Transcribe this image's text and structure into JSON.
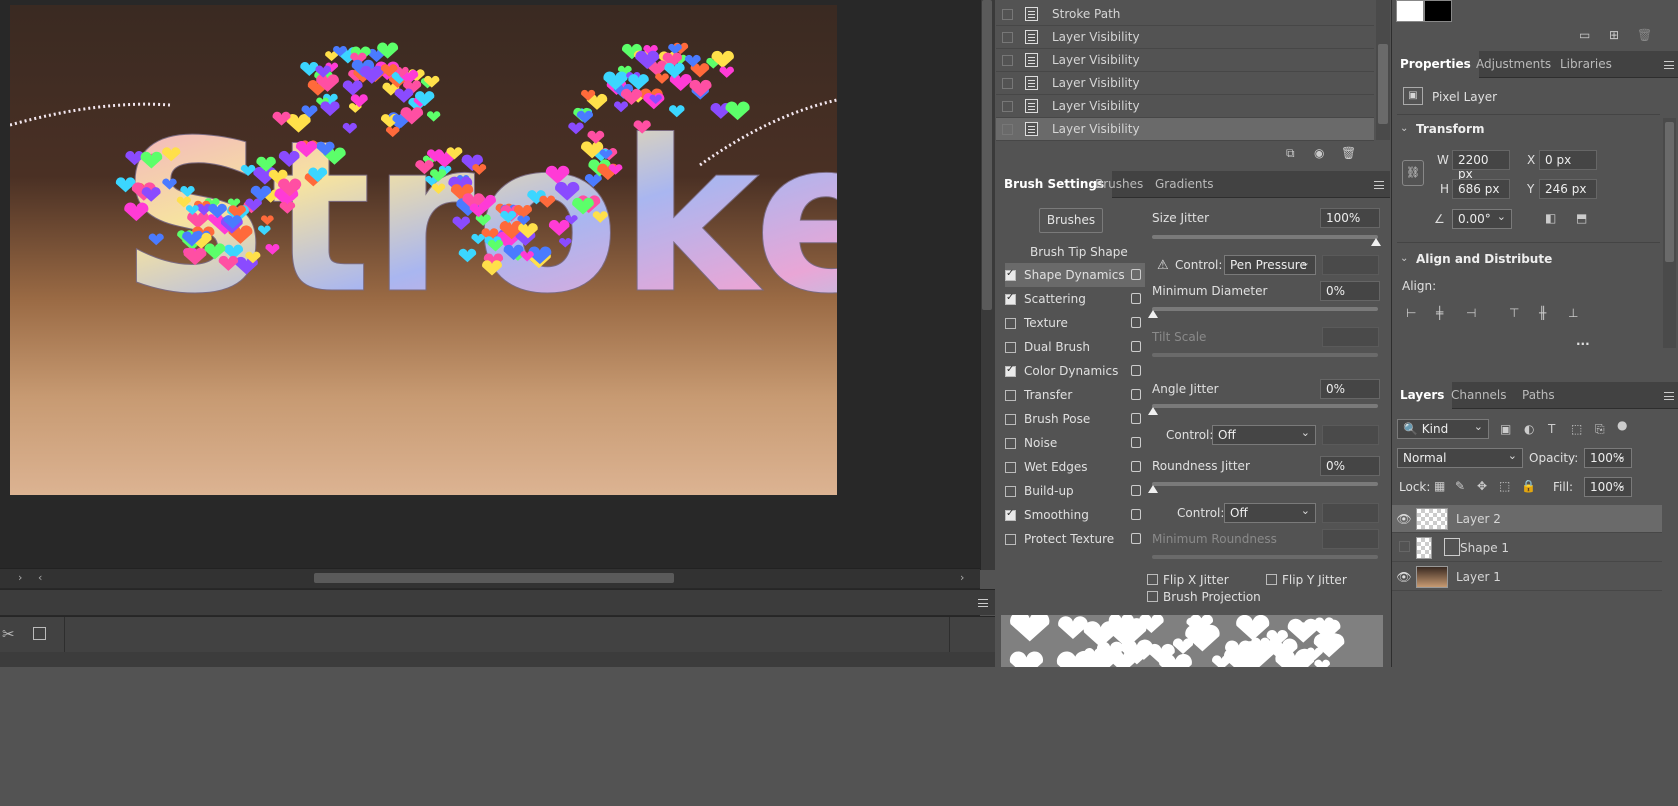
{
  "history": {
    "items": [
      {
        "label": "Stroke Path",
        "selected": false
      },
      {
        "label": "Layer Visibility",
        "selected": false
      },
      {
        "label": "Layer Visibility",
        "selected": false
      },
      {
        "label": "Layer Visibility",
        "selected": false
      },
      {
        "label": "Layer Visibility",
        "selected": false
      },
      {
        "label": "Layer Visibility",
        "selected": true
      }
    ]
  },
  "canvas": {
    "artwork_text": "Stroke"
  },
  "brush_panel": {
    "tabs": [
      "Brush Settings",
      "Brushes",
      "Gradients"
    ],
    "brushes_button": "Brushes",
    "tip_shape_header": "Brush Tip Shape",
    "options": [
      {
        "label": "Shape Dynamics",
        "checked": true,
        "selected": true
      },
      {
        "label": "Scattering",
        "checked": true,
        "selected": false
      },
      {
        "label": "Texture",
        "checked": false,
        "selected": false
      },
      {
        "label": "Dual Brush",
        "checked": false,
        "selected": false
      },
      {
        "label": "Color Dynamics",
        "checked": true,
        "selected": false
      },
      {
        "label": "Transfer",
        "checked": false,
        "selected": false
      },
      {
        "label": "Brush Pose",
        "checked": false,
        "selected": false
      },
      {
        "label": "Noise",
        "checked": false,
        "selected": false
      },
      {
        "label": "Wet Edges",
        "checked": false,
        "selected": false
      },
      {
        "label": "Build-up",
        "checked": false,
        "selected": false
      },
      {
        "label": "Smoothing",
        "checked": true,
        "selected": false
      },
      {
        "label": "Protect Texture",
        "checked": false,
        "selected": false
      }
    ],
    "size_jitter_label": "Size Jitter",
    "size_jitter_value": "100%",
    "control1_label": "Control:",
    "control1_value": "Pen Pressure",
    "min_diameter_label": "Minimum Diameter",
    "min_diameter_value": "0%",
    "tilt_scale_label": "Tilt Scale",
    "angle_jitter_label": "Angle Jitter",
    "angle_jitter_value": "0%",
    "control2_label": "Control:",
    "control2_value": "Off",
    "roundness_jitter_label": "Roundness Jitter",
    "roundness_jitter_value": "0%",
    "control3_label": "Control:",
    "control3_value": "Off",
    "min_roundness_label": "Minimum Roundness",
    "flip_x_label": "Flip X Jitter",
    "flip_y_label": "Flip Y Jitter",
    "projection_label": "Brush Projection"
  },
  "properties": {
    "tabs": [
      "Properties",
      "Adjustments",
      "Libraries"
    ],
    "layer_type": "Pixel Layer",
    "transform_title": "Transform",
    "w_label": "W",
    "w_value": "2200 px",
    "h_label": "H",
    "h_value": "686 px",
    "x_label": "X",
    "x_value": "0 px",
    "y_label": "Y",
    "y_value": "246 px",
    "angle_value": "0.00°",
    "align_title": "Align and Distribute",
    "align_label": "Align:",
    "more": "..."
  },
  "layers": {
    "tabs": [
      "Layers",
      "Channels",
      "Paths"
    ],
    "filter_kind": "Kind",
    "blend_mode": "Normal",
    "opacity_label": "Opacity:",
    "opacity_value": "100%",
    "lock_label": "Lock:",
    "fill_label": "Fill:",
    "fill_value": "100%",
    "items": [
      {
        "name": "Layer 2",
        "visible": true,
        "selected": true
      },
      {
        "name": "Shape 1",
        "visible": false,
        "selected": false
      },
      {
        "name": "Layer 1",
        "visible": true,
        "selected": false
      }
    ]
  }
}
